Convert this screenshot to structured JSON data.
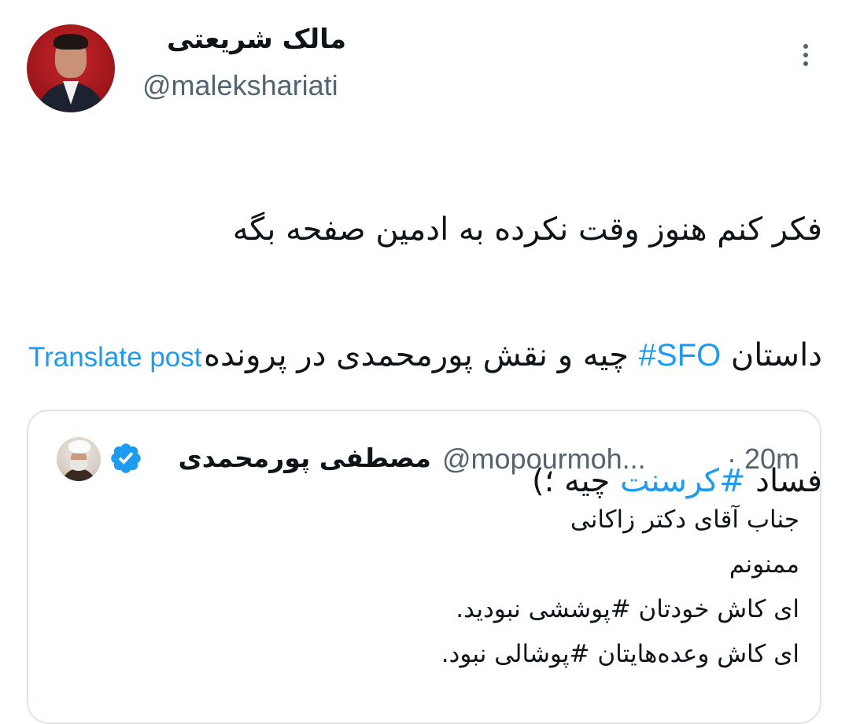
{
  "author": {
    "display_name": "مالک شریعتی",
    "handle": "@malekshariati"
  },
  "post": {
    "lines": [
      {
        "parts": [
          {
            "text": "فکر کنم هنوز وقت نکرده به ادمین صفحه بگه",
            "hashtag": false
          }
        ]
      },
      {
        "parts": [
          {
            "text": "داستان ",
            "hashtag": false
          },
          {
            "text": "#SFO",
            "hashtag": true
          },
          {
            "text": " چیه و نقش پورمحمدی در پرونده",
            "hashtag": false
          }
        ]
      },
      {
        "parts": [
          {
            "text": "فساد ",
            "hashtag": false
          },
          {
            "text": "#کرسنت",
            "hashtag": true
          },
          {
            "text": " چیه ؛)",
            "hashtag": false
          }
        ]
      }
    ]
  },
  "translate_label": "Translate post",
  "quote": {
    "display_name": "مصطفی پورمحمدی",
    "handle": "@mopourmoh...",
    "separator": "·",
    "time": "20m",
    "lines": [
      "جناب آقای دکتر زاکانی",
      "ممنونم",
      "ای کاش خودتان #پوششی نبودید.",
      "ای کاش وعده‌هایتان #پوشالی نبود."
    ]
  },
  "colors": {
    "accent": "#1d9bf0",
    "secondary_text": "#536471",
    "border": "#dfe4e8"
  },
  "icons": {
    "more": "more-vertical-icon",
    "verified": "verified-badge-icon"
  }
}
